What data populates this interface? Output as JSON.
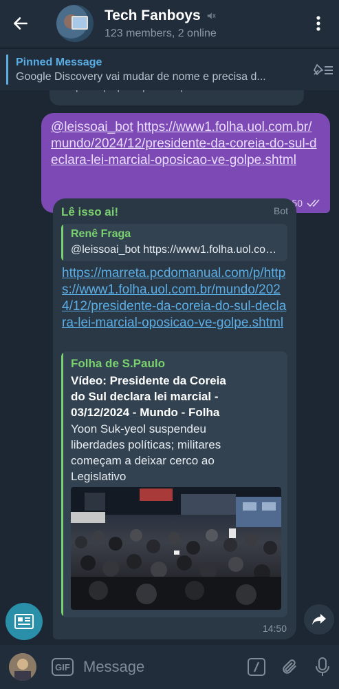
{
  "header": {
    "title": "Tech Fanboys",
    "subtitle": "123 members, 2 online",
    "back_icon": "arrow-left-icon",
    "menu_icon": "more-vertical-icon",
    "muted_icon": "muted-speaker-icon"
  },
  "pinned": {
    "title": "Pinned Message",
    "body": "Google Discovery vai mudar de nome e precisa d..."
  },
  "previous_message": {
    "text": "Clique aqui para provar que você é humano"
  },
  "outgoing": {
    "mention": "@leissoai_bot",
    "url": "https://www1.folha.uol.com.br/mundo/2024/12/presidente-da-coreia-do-sul-declara-lei-marcial-oposicao-ve-golpe.shtml",
    "reply_count": "1",
    "time": "edited 14:50",
    "status_icon": "double-check-icon"
  },
  "incoming": {
    "sender": "Lê isso ai!",
    "tag": "Bot",
    "reply": {
      "name": "Renê Fraga",
      "text": "@leissoai_bot https://www1.folha.uol.com.br/mundo/2024/12/presidente-da-coreia-do-sul-declara-lei-marcial-oposicao-ve-golpe.shtml"
    },
    "link": "https://marreta.pcdomanual.com/p/https://www1.folha.uol.com.br/mundo/2024/12/presidente-da-coreia-do-sul-declara-lei-marcial-oposicao-ve-golpe.shtml",
    "preview": {
      "site": "Folha de S.Paulo",
      "title": "Vídeo: Presidente da Coreia do Sul declara lei marcial - 03/12/2024 - Mundo - Folha",
      "description": "Yoon Suk-yeol suspendeu liberdades políticas; militares começam a deixar cerco ao Legislativo"
    },
    "time": "14:50"
  },
  "input": {
    "placeholder": "Message",
    "gif_label": "GIF"
  },
  "colors": {
    "background": "#1c2733",
    "header": "#212d3b",
    "outgoing_bubble": "#7d49b4",
    "incoming_bubble": "#2a3745",
    "accent_green": "#7ad26f",
    "link_blue": "#5aaee5"
  }
}
